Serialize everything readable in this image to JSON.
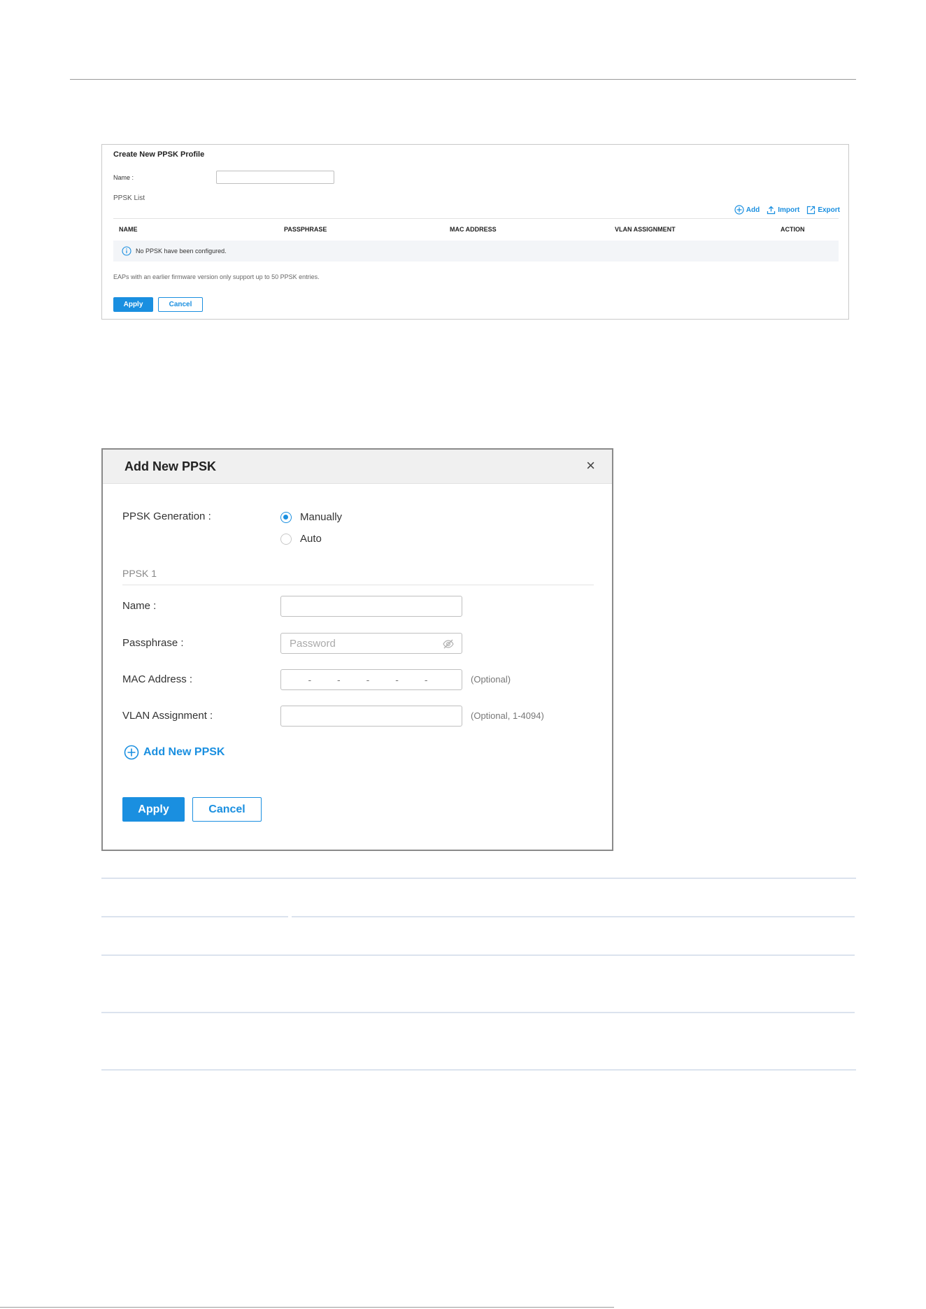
{
  "create_profile": {
    "title": "Create New PPSK Profile",
    "name_label": "Name :",
    "name_value": "",
    "list_label": "PPSK List",
    "actions": {
      "add": "Add",
      "import": "Import",
      "export": "Export"
    },
    "columns": [
      "NAME",
      "PASSPHRASE",
      "MAC ADDRESS",
      "VLAN ASSIGNMENT",
      "ACTION"
    ],
    "empty_message": "No PPSK have been configured.",
    "note": "EAPs with an earlier firmware version only support up to 50 PPSK entries.",
    "apply_label": "Apply",
    "cancel_label": "Cancel"
  },
  "dialog": {
    "title": "Add New PPSK",
    "close_glyph": "×",
    "generation_label": "PPSK Generation :",
    "generation_options": [
      {
        "label": "Manually",
        "selected": true
      },
      {
        "label": "Auto",
        "selected": false
      }
    ],
    "section_title": "PPSK 1",
    "name_label": "Name :",
    "passphrase_label": "Passphrase :",
    "passphrase_placeholder": "Password",
    "mac_label": "MAC Address :",
    "mac_separators": [
      "-",
      "-",
      "-",
      "-",
      "-"
    ],
    "mac_hint": "(Optional)",
    "vlan_label": "VLAN Assignment :",
    "vlan_hint": "(Optional, 1-4094)",
    "add_new_label": "Add New PPSK",
    "apply_label": "Apply",
    "cancel_label": "Cancel"
  },
  "colors": {
    "accent": "#1a8fe0",
    "border": "#bfbfbf",
    "header_bg": "#f0f0f0"
  }
}
